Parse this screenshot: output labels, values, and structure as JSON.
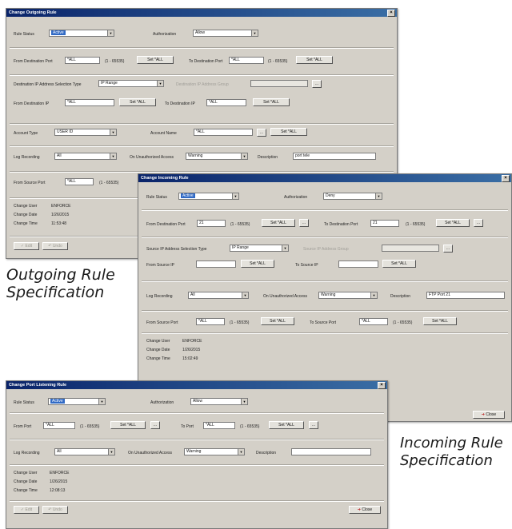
{
  "outgoing": {
    "title": "Change Outgoing Rule",
    "rule_status_label": "Rule Status",
    "rule_status": "Active",
    "authorization_label": "Authorization",
    "authorization": "Allow",
    "from_dest_port_label": "From Destination Port",
    "from_dest_port": "*ALL",
    "range1": "(1 - 65535)",
    "set_all": "Set *ALL",
    "to_dest_port_label": "To Destination Port",
    "to_dest_port": "*ALL",
    "range2": "(1 - 65535)",
    "dest_ip_sel_label": "Destination IP Address Selection Type",
    "dest_ip_sel": "IP Range",
    "dest_ip_group_label": "Destination IP Address Group",
    "from_dest_ip_label": "From Destination IP",
    "from_dest_ip": "*ALL",
    "to_dest_ip_label": "To Destination IP",
    "to_dest_ip": "*ALL",
    "account_type_label": "Account Type",
    "account_type": "USER ID",
    "account_name_label": "Account Name",
    "account_name": "*ALL",
    "log_recording_label": "Log Recording",
    "log_recording": "All",
    "unauth_label": "On Unauthorized Access",
    "unauth": "Warning",
    "description_label": "Description",
    "description": "port tele",
    "from_source_port_label": "From Source Port",
    "from_source_port": "*ALL",
    "range3": "(1 - 65535)",
    "change_user_label": "Change User",
    "change_user": "ENFORCE",
    "change_date_label": "Change Date",
    "change_date": "1/26/2015",
    "change_time_label": "Change Time",
    "change_time": "11:53:48",
    "edit": "Edit",
    "undo": "Undo",
    "ellipsis": "..."
  },
  "incoming": {
    "title": "Change Incoming Rule",
    "rule_status_label": "Rule Status",
    "rule_status": "Active",
    "authorization_label": "Authorization",
    "authorization": "Deny",
    "from_dest_port_label": "From Destination Port",
    "from_dest_port": "21",
    "range1": "(1 - 65535)",
    "set_all": "Set *ALL",
    "to_dest_port_label": "To Destination Port",
    "to_dest_port": "21",
    "range2": "(1 - 65535)",
    "src_ip_sel_label": "Source IP Address Selection Type",
    "src_ip_sel": "IP Range",
    "src_ip_group_label": "Source IP Address Group",
    "from_src_ip_label": "From Source IP",
    "to_src_ip_label": "To Source IP",
    "log_recording_label": "Log Recording",
    "log_recording": "All",
    "unauth_label": "On Unauthorized Access",
    "unauth": "Warning",
    "description_label": "Description",
    "description": "FTP Port 21",
    "from_source_port_label": "From Source Port",
    "from_source_port": "*ALL",
    "range3": "(1 - 65535)",
    "to_source_port_label": "To Source Port",
    "to_source_port": "*ALL",
    "range4": "(1 - 65535)",
    "change_user_label": "Change User",
    "change_user": "ENFORCE",
    "change_date_label": "Change Date",
    "change_date": "1/26/2015",
    "change_time_label": "Change Time",
    "change_time": "15:02:49",
    "close": "Close",
    "ellipsis": "..."
  },
  "listening": {
    "title": "Change Port Listening Rule",
    "rule_status_label": "Rule Status",
    "rule_status": "Active",
    "authorization_label": "Authorization",
    "authorization": "Allow",
    "from_port_label": "From Port",
    "from_port": "*ALL",
    "range1": "(1 - 65535)",
    "set_all": "Set *ALL",
    "to_port_label": "To Port",
    "to_port": "*ALL",
    "range2": "(1 - 65535)",
    "log_recording_label": "Log Recording",
    "log_recording": "All",
    "unauth_label": "On Unauthorized Access",
    "unauth": "Warning",
    "description_label": "Description",
    "description": "",
    "change_user_label": "Change User",
    "change_user": "ENFORCE",
    "change_date_label": "Change Date",
    "change_date": "1/26/2015",
    "change_time_label": "Change Time",
    "change_time": "12:08:13",
    "edit": "Edit",
    "undo": "Undo",
    "close": "Close",
    "ellipsis": "..."
  },
  "captions": {
    "outgoing_line1": "Outgoing Rule",
    "outgoing_line2": "Specification",
    "incoming_line1": "Incoming Rule",
    "incoming_line2": "Specification"
  },
  "colors": {
    "titlebar": "#0a246a",
    "window": "#d4d0c8",
    "selection": "#316ac5"
  }
}
